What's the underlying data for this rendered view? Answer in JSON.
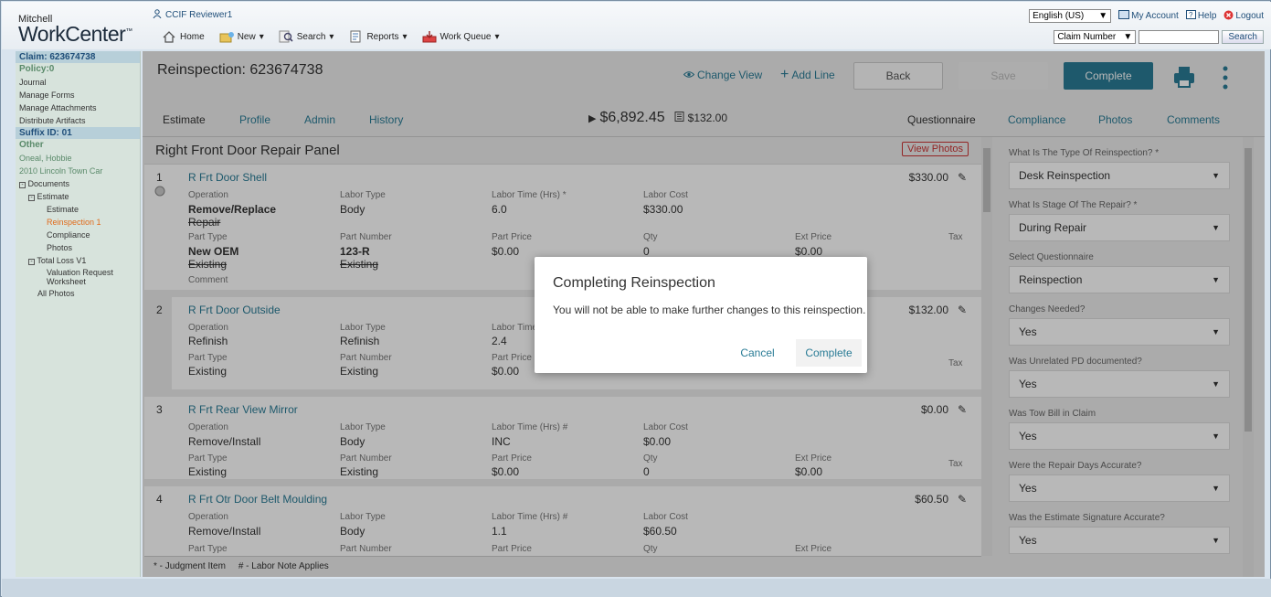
{
  "header": {
    "logo_top": "Mitchell",
    "logo_main": "WorkCenter",
    "logo_tm": "™",
    "user": "CCIF Reviewer1",
    "nav": [
      {
        "label": "Home",
        "arrow": ""
      },
      {
        "label": "New",
        "arrow": "▾"
      },
      {
        "label": "Search",
        "arrow": "▾"
      },
      {
        "label": "Reports",
        "arrow": "▾"
      },
      {
        "label": "Work Queue",
        "arrow": "▾"
      }
    ],
    "language": "English (US)",
    "links": {
      "account": "My Account",
      "help": "Help",
      "logout": "Logout"
    },
    "search_type": "Claim Number",
    "search_value": "",
    "search_button": "Search"
  },
  "left": {
    "claim": "Claim: 623674738",
    "policy": "Policy:0",
    "links": [
      "Journal",
      "Manage Forms",
      "Manage Attachments",
      "Distribute Artifacts"
    ],
    "suffix": "Suffix ID: 01",
    "other": "Other",
    "owner": "Oneal, Hobbie",
    "vehicle": "2010 Lincoln Town Car",
    "documents": "Documents",
    "estimate": "Estimate",
    "estimate_child": "Estimate",
    "reinspection": "Reinspection 1",
    "compliance": "Compliance",
    "photos": "Photos",
    "total_loss": "Total Loss V1",
    "valuation": "Valuation Request Worksheet",
    "all_photos": "All Photos"
  },
  "main": {
    "title": "Reinspection: 623674738",
    "change_view": "Change View",
    "add_line": "Add Line",
    "back": "Back",
    "save": "Save",
    "complete": "Complete",
    "tabs_left": [
      "Estimate",
      "Profile",
      "Admin",
      "History"
    ],
    "total": "$6,892.45",
    "sub_total": "$132.00",
    "tabs_right": [
      "Questionnaire",
      "Compliance",
      "Photos",
      "Comments"
    ],
    "panel_title": "Right Front Door Repair Panel",
    "view_photos": "View Photos",
    "footer": "* - Judgment Item     # - Labor Note Applies"
  },
  "labels": {
    "operation": "Operation",
    "labor_type": "Labor Type",
    "labor_time": "Labor Time (Hrs)",
    "labor_cost": "Labor Cost",
    "part_type": "Part Type",
    "part_number": "Part Number",
    "part_price": "Part Price",
    "qty": "Qty",
    "ext_price": "Ext Price",
    "tax": "Tax",
    "comment": "Comment"
  },
  "lines": [
    {
      "no": "1",
      "name": "R Frt Door Shell",
      "amount": "$330.00",
      "operation": "Remove/Replace",
      "operation_old": "Repair",
      "labor_type": "Body",
      "labor_time_mark": "*",
      "labor_time": "6.0",
      "labor_cost": "$330.00",
      "part_type": "New OEM",
      "part_type_old": "Existing",
      "part_number": "123-R",
      "part_number_old": "Existing",
      "part_price": "$0.00",
      "qty": "0",
      "ext_price": "$0.00"
    },
    {
      "no": "2",
      "name": "R Frt Door Outside",
      "amount": "$132.00",
      "operation": "Refinish",
      "labor_type": "Refinish",
      "labor_time_short": "Labor Time",
      "labor_time": "2.4",
      "part_type": "Existing",
      "part_number": "Existing",
      "part_price": "$0.00"
    },
    {
      "no": "3",
      "name": "R Frt Rear View Mirror",
      "amount": "$0.00",
      "operation": "Remove/Install",
      "labor_type": "Body",
      "labor_time_mark": "#",
      "labor_time": "INC",
      "labor_cost": "$0.00",
      "part_type": "Existing",
      "part_number": "Existing",
      "part_price": "$0.00",
      "qty": "0",
      "ext_price": "$0.00"
    },
    {
      "no": "4",
      "name": "R Frt Otr Door Belt Moulding",
      "amount": "$60.50",
      "operation": "Remove/Install",
      "labor_type": "Body",
      "labor_time_mark": "#",
      "labor_time": "1.1",
      "labor_cost": "$60.50"
    }
  ],
  "questionnaire": [
    {
      "label": "What Is The Type Of Reinspection? *",
      "value": "Desk Reinspection"
    },
    {
      "label": "What Is Stage Of The Repair? *",
      "value": "During Repair"
    },
    {
      "label": "Select Questionnaire",
      "value": "Reinspection"
    },
    {
      "label": "Changes Needed?",
      "value": "Yes"
    },
    {
      "label": "Was Unrelated PD documented?",
      "value": "Yes"
    },
    {
      "label": "Was Tow Bill in Claim",
      "value": "Yes"
    },
    {
      "label": "Were the Repair Days Accurate?",
      "value": "Yes"
    },
    {
      "label": "Was the Estimate Signature Accurate?",
      "value": "Yes"
    }
  ],
  "modal": {
    "title": "Completing Reinspection",
    "message": "You will not be able to make further changes to this reinspection.",
    "cancel": "Cancel",
    "complete": "Complete"
  }
}
